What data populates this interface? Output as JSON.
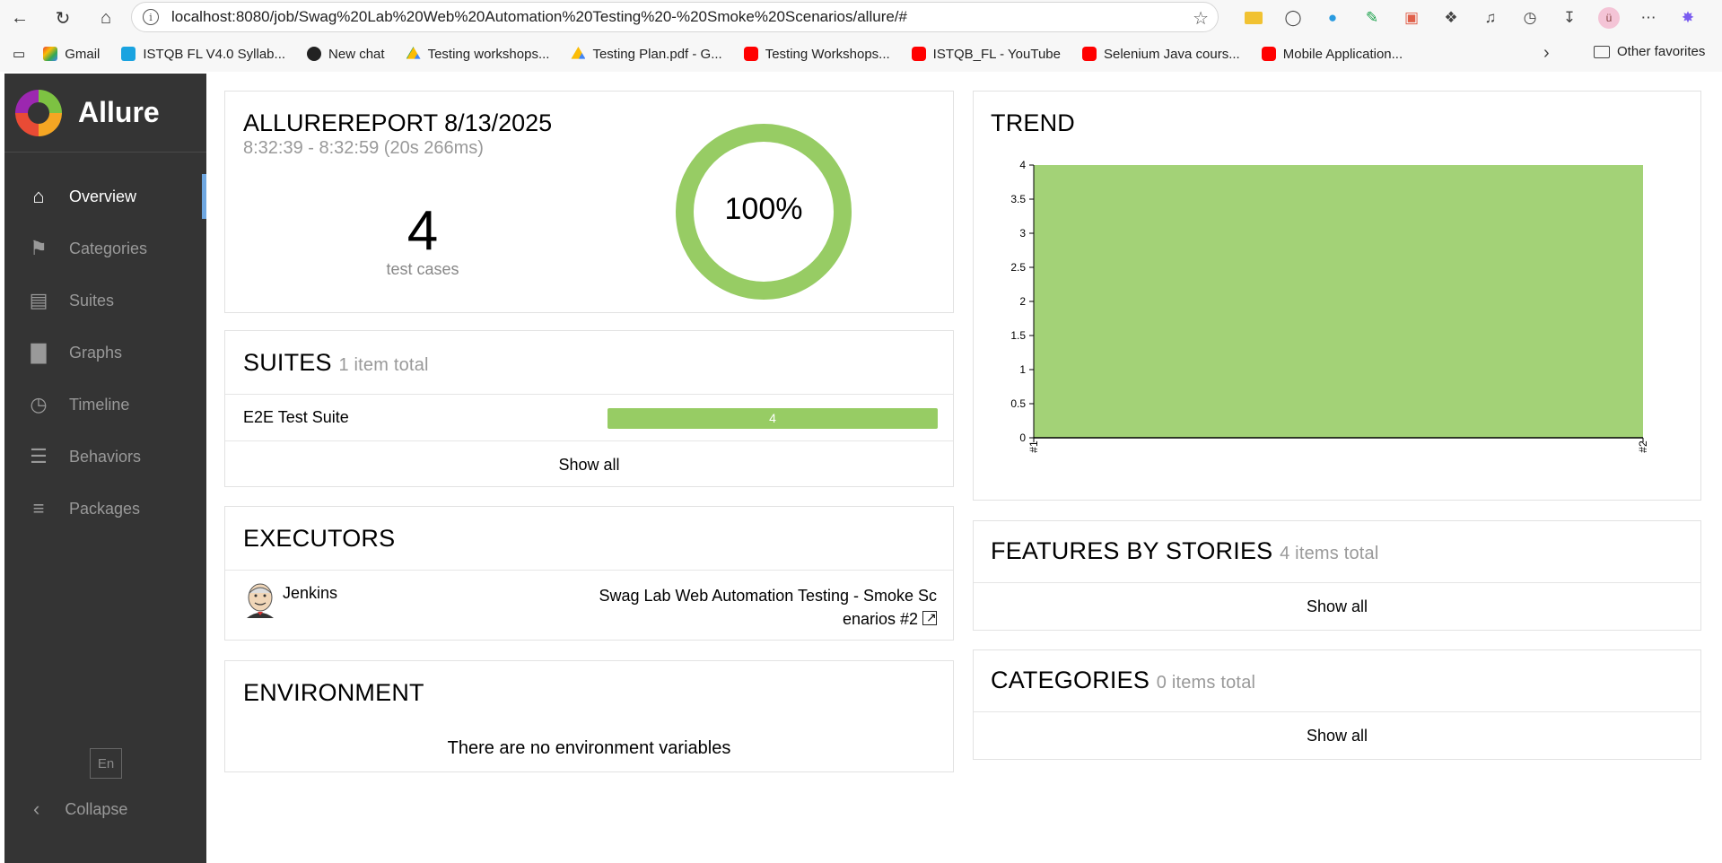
{
  "browser": {
    "url": "localhost:8080/job/Swag%20Lab%20Web%20Automation%20Testing%20-%20Smoke%20Scenarios/allure/#",
    "info_glyph": "i",
    "avatar_initial": "ü",
    "bookmarks": [
      {
        "label": "Gmail",
        "icon": "gmail"
      },
      {
        "label": "ISTQB FL V4.0 Syllab...",
        "icon": "istqb"
      },
      {
        "label": "New chat",
        "icon": "chat"
      },
      {
        "label": "Testing workshops...",
        "icon": "drive"
      },
      {
        "label": "Testing Plan.pdf - G...",
        "icon": "drive"
      },
      {
        "label": "Testing Workshops...",
        "icon": "yt"
      },
      {
        "label": "ISTQB_FL - YouTube",
        "icon": "yt"
      },
      {
        "label": "Selenium Java cours...",
        "icon": "yt"
      },
      {
        "label": "Mobile Application...",
        "icon": "yt"
      }
    ],
    "other_favorites": "Other favorites"
  },
  "sidebar": {
    "brand": "Allure",
    "items": [
      {
        "label": "Overview",
        "icon": "home-icon",
        "active": true
      },
      {
        "label": "Categories",
        "icon": "flag-icon"
      },
      {
        "label": "Suites",
        "icon": "briefcase-icon"
      },
      {
        "label": "Graphs",
        "icon": "bar-chart-icon"
      },
      {
        "label": "Timeline",
        "icon": "clock-icon"
      },
      {
        "label": "Behaviors",
        "icon": "list-icon"
      },
      {
        "label": "Packages",
        "icon": "align-left-icon"
      }
    ],
    "language": "En",
    "collapse": "Collapse"
  },
  "summary": {
    "title": "ALLUREREPORT 8/13/2025",
    "time": "8:32:39 - 8:32:59 (20s 266ms)",
    "count": "4",
    "count_label": "test cases",
    "percent": "100%",
    "pass_fraction": 1.0,
    "pass_color": "#97cc64"
  },
  "suites": {
    "title": "SUITES",
    "subtitle": "1 item total",
    "rows": [
      {
        "name": "E2E Test Suite",
        "passed": "4"
      }
    ],
    "show_all": "Show all"
  },
  "executors": {
    "title": "EXECUTORS",
    "name": "Jenkins",
    "build_line1": "Swag Lab Web Automation Testing - Smoke Sc",
    "build_line2": "enarios #2"
  },
  "environment": {
    "title": "ENVIRONMENT",
    "empty": "There are no environment variables"
  },
  "trend": {
    "title": "TREND"
  },
  "features": {
    "title": "FEATURES BY STORIES",
    "subtitle": "4 items total",
    "show_all": "Show all"
  },
  "categories": {
    "title": "CATEGORIES",
    "subtitle": "0 items total",
    "show_all": "Show all"
  },
  "chart_data": {
    "type": "area",
    "x": [
      "#1",
      "#2"
    ],
    "series": [
      {
        "values": [
          4,
          4
        ],
        "color": "#a3d277"
      }
    ],
    "ylim": [
      0,
      4
    ],
    "yticks": [
      "0",
      "0.5",
      "1",
      "1.5",
      "2",
      "2.5",
      "3",
      "3.5",
      "4"
    ],
    "grid": false
  }
}
